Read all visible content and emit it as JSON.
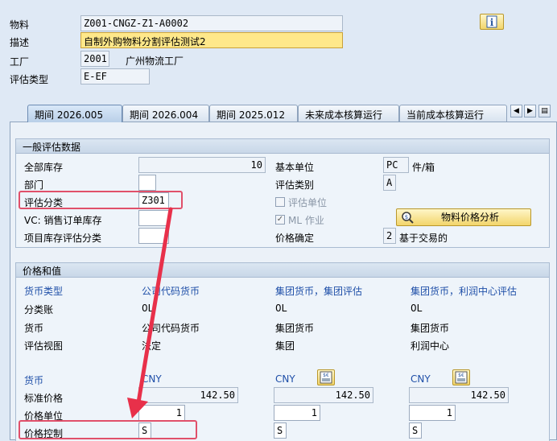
{
  "header": {
    "material_label": "物料",
    "material_value": "Z001-CNGZ-Z1-A0002",
    "desc_label": "描述",
    "desc_value": "自制外购物料分割评估测试2",
    "plant_label": "工厂",
    "plant_value": "2001",
    "plant_name": "广州物流工厂",
    "valtype_label": "评估类型",
    "valtype_value": "E-EF"
  },
  "tabs": [
    {
      "label": "期间 2026.005"
    },
    {
      "label": "期间 2026.004"
    },
    {
      "label": "期间 2025.012"
    },
    {
      "label": "未来成本核算运行"
    },
    {
      "label": "当前成本核算运行"
    }
  ],
  "general": {
    "title": "一般评估数据",
    "total_stock_label": "全部库存",
    "total_stock_value": "10",
    "dept_label": "部门",
    "dept_value": "",
    "valclass_label": "评估分类",
    "valclass_value": "Z301",
    "vc_label": "VC: 销售订单库存",
    "vc_value": "",
    "proj_label": "项目库存评估分类",
    "proj_value": "",
    "base_unit_label": "基本单位",
    "base_unit_value": "PC",
    "base_unit_text": "件/箱",
    "valcat_label": "评估类别",
    "valcat_value": "A",
    "valunit_label": "评估单位",
    "ml_label": "ML 作业",
    "price_det_label": "价格确定",
    "price_det_value": "2",
    "price_det_text": "基于交易的",
    "analysis_button": "物料价格分析"
  },
  "price": {
    "title": "价格和值",
    "curtype_label": "货币类型",
    "col1_header": "公司代码货币",
    "col2_header": "集团货币，集团评估",
    "col3_header": "集团货币，利润中心评估",
    "ledger_label": "分类账",
    "ledger_values": [
      "0L",
      "0L",
      "0L"
    ],
    "currency_label": "货币",
    "currency_values": [
      "公司代码货币",
      "集团货币",
      "集团货币"
    ],
    "view_label": "评估视图",
    "view_values": [
      "法定",
      "集团",
      "利润中心"
    ],
    "curr2_label": "货币",
    "curr2_values": [
      "CNY",
      "CNY",
      "CNY"
    ],
    "std_label": "标准价格",
    "std_values": [
      "142.50",
      "142.50",
      "142.50"
    ],
    "unit_label": "价格单位",
    "unit_values": [
      "1",
      "1",
      "1"
    ],
    "ctrl_label": "价格控制",
    "ctrl_values": [
      "S",
      "S",
      "S"
    ]
  },
  "colors": {
    "highlight": "#e0506a",
    "arrow": "#e8304a",
    "blue_text": "#1f4fa8"
  }
}
